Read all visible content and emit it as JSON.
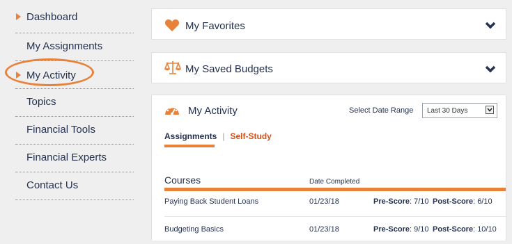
{
  "sidebar": {
    "items": [
      {
        "label": "Dashboard"
      },
      {
        "label": "My Assignments"
      },
      {
        "label": "My Activity"
      },
      {
        "label": "Topics"
      },
      {
        "label": "Financial Tools"
      },
      {
        "label": "Financial Experts"
      },
      {
        "label": "Contact Us"
      }
    ],
    "accent": "#e8823a"
  },
  "favorites": {
    "title": "My Favorites",
    "icon": "heart-icon"
  },
  "budgets": {
    "title": "My Saved Budgets",
    "icon": "scale-icon"
  },
  "activity": {
    "title": "My Activity",
    "icon": "speedometer-icon",
    "date_range_label": "Select Date Range",
    "date_range_value": "Last 30 Days",
    "tabs": [
      "Assignments",
      "Self-Study"
    ],
    "courses_header": "Courses",
    "date_header": "Date Completed",
    "rows": [
      {
        "name": "Paying Back Student Loans",
        "date": "01/23/18",
        "pre_label": "Pre-Score",
        "pre": ": 7/10",
        "post_label": "Post-Score",
        "post": ": 6/10"
      },
      {
        "name": "Budgeting Basics",
        "date": "01/23/18",
        "pre_label": "Pre-Score",
        "pre": ": 9/10",
        "post_label": "Post-Score",
        "post": ": 10/10"
      }
    ]
  },
  "colors": {
    "accent": "#e8823a",
    "navy": "#24314f",
    "self_study": "#d4531a"
  }
}
